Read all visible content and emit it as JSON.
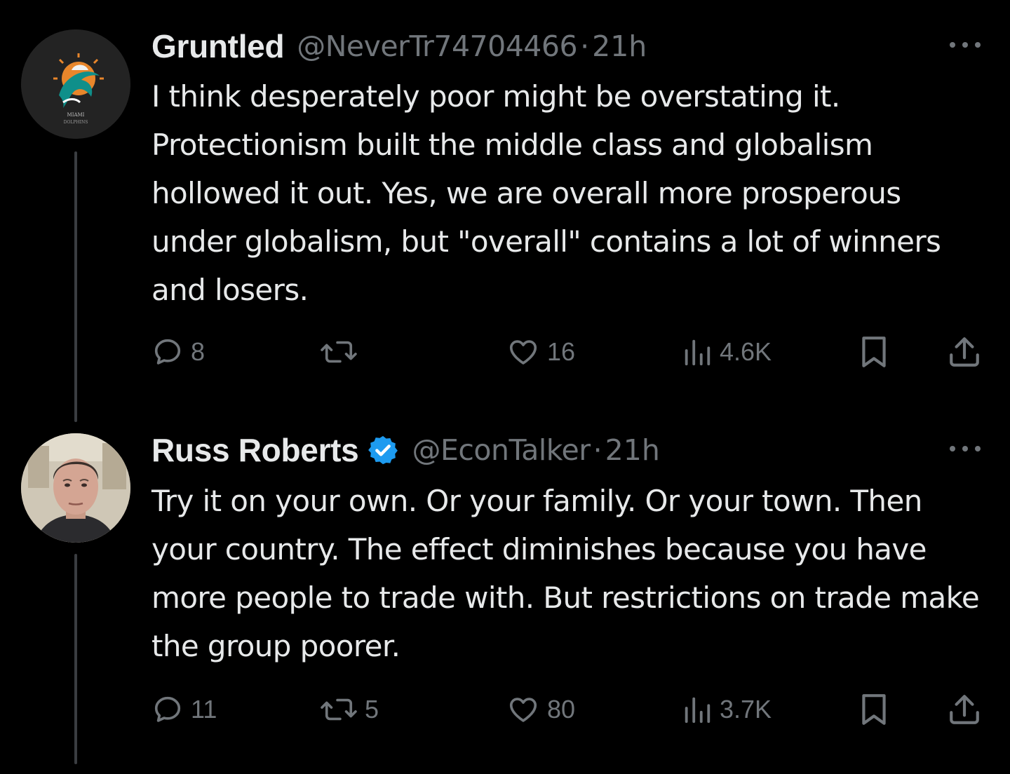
{
  "tweets": [
    {
      "display_name": "Gruntled",
      "verified": false,
      "handle": "@NeverTr74704466",
      "separator": "·",
      "time": "21h",
      "text": "I think desperately poor might be overstating it. Protectionism built the middle class and globalism hollowed it out. Yes, we are overall more prosperous under globalism, but \"overall\" contains a lot of winners and losers.",
      "avatar": "miami-dolphins-logo",
      "stats": {
        "replies": "8",
        "retweets": "",
        "likes": "16",
        "views": "4.6K"
      }
    },
    {
      "display_name": "Russ Roberts",
      "verified": true,
      "handle": "@EconTalker",
      "separator": "·",
      "time": "21h",
      "text": "Try it on your own. Or your family. Or your town. Then your country. The effect diminishes because you have more people to trade with. But restrictions on trade make the group poorer.",
      "avatar": "profile-photo",
      "stats": {
        "replies": "11",
        "retweets": "5",
        "likes": "80",
        "views": "3.7K"
      }
    }
  ],
  "icons": [
    "reply-icon",
    "retweet-icon",
    "like-icon",
    "views-icon",
    "bookmark-icon",
    "share-icon",
    "more-icon",
    "verified-badge-icon"
  ],
  "colors": {
    "background": "#000000",
    "text_primary": "#e7e9ea",
    "text_secondary": "#71767b",
    "verified_blue": "#1d9bf0",
    "thread_line": "#3a3d41"
  }
}
